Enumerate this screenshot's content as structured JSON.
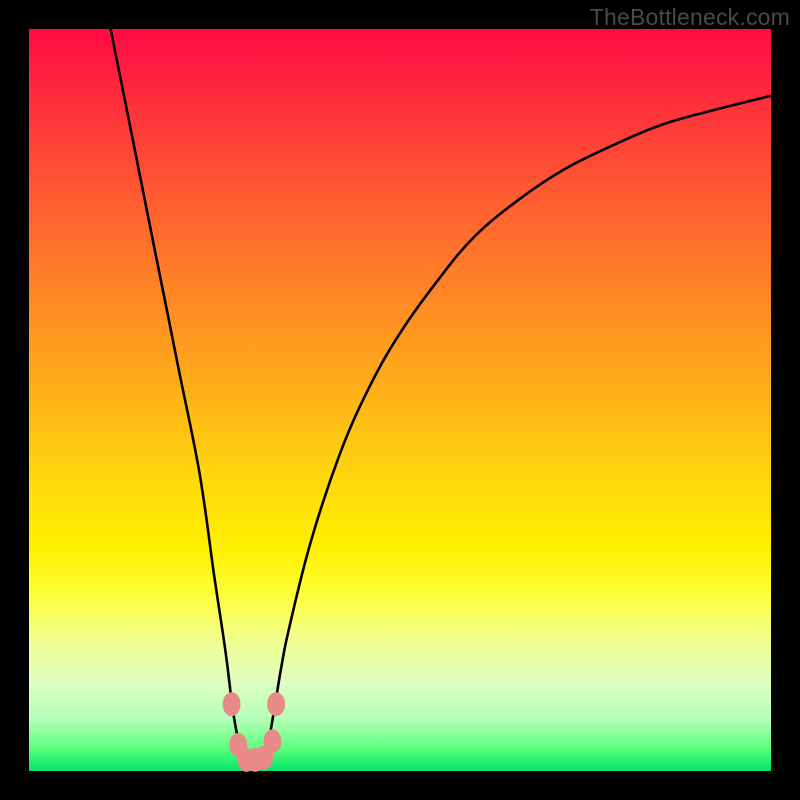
{
  "watermark": "TheBottleneck.com",
  "chart_data": {
    "type": "line",
    "title": "",
    "xlabel": "",
    "ylabel": "",
    "xlim": [
      0,
      100
    ],
    "ylim": [
      0,
      100
    ],
    "series": [
      {
        "name": "curve",
        "x": [
          11,
          14,
          17,
          20,
          23,
          25,
          26.5,
          27.5,
          28.5,
          29.5,
          30.5,
          32,
          33,
          34,
          35,
          38,
          42,
          46,
          50,
          55,
          60,
          66,
          72,
          78,
          85,
          92,
          100
        ],
        "values": [
          100,
          85,
          70,
          55,
          40,
          26,
          16,
          8,
          3,
          1,
          1,
          3,
          8,
          14,
          19,
          31,
          43,
          52,
          59,
          66,
          72,
          77,
          81,
          84,
          87,
          89,
          91
        ]
      }
    ],
    "markers": [
      {
        "name": "dot-left-upper",
        "x": 27.3,
        "y": 9.0
      },
      {
        "name": "dot-left-lower",
        "x": 28.2,
        "y": 3.5
      },
      {
        "name": "dot-mid-a",
        "x": 29.3,
        "y": 1.5
      },
      {
        "name": "dot-mid-b",
        "x": 30.5,
        "y": 1.5
      },
      {
        "name": "dot-mid-c",
        "x": 31.7,
        "y": 1.8
      },
      {
        "name": "dot-right-lower",
        "x": 32.8,
        "y": 4.0
      },
      {
        "name": "dot-right-upper",
        "x": 33.3,
        "y": 9.0
      }
    ],
    "marker_color": "#e88a87",
    "grid": false,
    "legend": false
  }
}
